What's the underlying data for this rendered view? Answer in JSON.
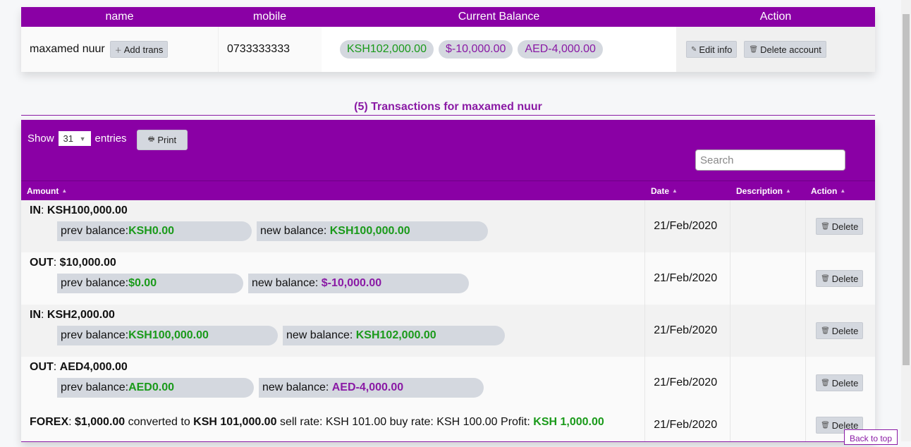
{
  "account_table": {
    "headers": {
      "name": "name",
      "mobile": "mobile",
      "balance": "Current Balance",
      "action": "Action"
    },
    "row": {
      "name": "maxamed nuur",
      "add_trans": "Add trans",
      "mobile": "0733333333",
      "balances": [
        "KSH102,000.00",
        "$-10,000.00",
        "AED-4,000.00"
      ],
      "edit_info": "Edit info",
      "delete_account": "Delete account"
    }
  },
  "section_title": "(5) Transactions for maxamed nuur",
  "controls": {
    "show_label": "Show",
    "entries_value": "31",
    "entries_label": "entries",
    "print_label": "Print",
    "search_placeholder": "Search"
  },
  "transactions_table": {
    "headers": {
      "amount": "Amount",
      "date": "Date",
      "description": "Description",
      "action": "Action"
    },
    "rows": [
      {
        "type": "IN",
        "amount": "KSH100,000.00",
        "prev_label": "prev balance:",
        "prev": "KSH0.00",
        "new_label": "new balance: ",
        "new": "KSH100,000.00",
        "date": "21/Feb/2020",
        "delete": "Delete"
      },
      {
        "type": "OUT",
        "amount": "$10,000.00",
        "prev_label": "prev balance:",
        "prev": "$0.00",
        "new_label": "new balance: ",
        "new": "$-10,000.00",
        "date": "21/Feb/2020",
        "delete": "Delete"
      },
      {
        "type": "IN",
        "amount": "KSH2,000.00",
        "prev_label": "prev balance:",
        "prev": "KSH100,000.00",
        "new_label": "new balance: ",
        "new": "KSH102,000.00",
        "date": "21/Feb/2020",
        "delete": "Delete"
      },
      {
        "type": "OUT",
        "amount": "AED4,000.00",
        "prev_label": "prev balance:",
        "prev": "AED0.00",
        "new_label": "new balance: ",
        "new": "AED-4,000.00",
        "date": "21/Feb/2020",
        "delete": "Delete"
      }
    ],
    "forex": {
      "label": "FOREX",
      "amount": "$1,000.00",
      "converted_to_label": "converted to",
      "converted_amount": "KSH 101,000.00",
      "sell_rate_text": "sell rate: KSH 101.00",
      "buy_rate_text": "buy rate: KSH 100.00",
      "profit_label": "Profit:",
      "profit": "KSH 1,000.00",
      "date": "21/Feb/2020",
      "delete": "Delete"
    }
  },
  "back_to_top": "Back to top",
  "colors": {
    "brand": "#8a00a5",
    "positive": "#1a9a1a",
    "negative": "#8a1aa5"
  }
}
